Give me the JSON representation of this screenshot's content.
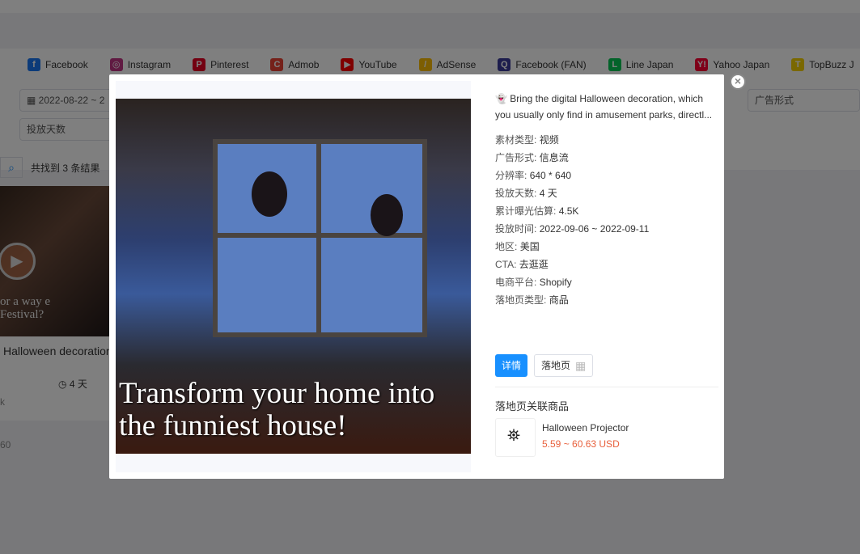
{
  "platforms": [
    {
      "label": "Facebook",
      "icon": "facebook-icon",
      "color": "#1877f2",
      "glyph": "f"
    },
    {
      "label": "Instagram",
      "icon": "instagram-icon",
      "color": "#c13584",
      "glyph": "◎"
    },
    {
      "label": "Pinterest",
      "icon": "pinterest-icon",
      "color": "#e60023",
      "glyph": "P"
    },
    {
      "label": "Admob",
      "icon": "admob-icon",
      "color": "#ea4335",
      "glyph": "C"
    },
    {
      "label": "YouTube",
      "icon": "youtube-icon",
      "color": "#ff0000",
      "glyph": "▶"
    },
    {
      "label": "AdSense",
      "icon": "adsense-icon",
      "color": "#fbbc04",
      "glyph": "/"
    },
    {
      "label": "Facebook (FAN)",
      "icon": "facebook-fan-icon",
      "color": "#3b3b9b",
      "glyph": "Q"
    },
    {
      "label": "Line Japan",
      "icon": "line-icon",
      "color": "#06c755",
      "glyph": "L"
    },
    {
      "label": "Yahoo Japan",
      "icon": "yahoo-icon",
      "color": "#ff0033",
      "glyph": "Y!"
    },
    {
      "label": "TopBuzz J",
      "icon": "topbuzz-icon",
      "color": "#f5d000",
      "glyph": "T"
    }
  ],
  "filters": {
    "date_range": "2022-08-22 ~ 2",
    "ad_format": "广告形式",
    "days": "投放天数"
  },
  "results": {
    "count_text": "共找到 3 条结果"
  },
  "card": {
    "caption": "or a way e Festival?",
    "title": "Halloween decoration",
    "days": "4 天",
    "meta1": "k",
    "meta2": "60"
  },
  "modal": {
    "video_caption": "Transform your home into the funniest house!",
    "description": "Bring the digital Halloween decoration, which you usually only find in amusement parks, directl...",
    "fields": [
      {
        "k": "素材类型:",
        "v": "视频"
      },
      {
        "k": "广告形式:",
        "v": "信息流"
      },
      {
        "k": "分辨率:",
        "v": "640 * 640"
      },
      {
        "k": "投放天数:",
        "v": "4 天"
      },
      {
        "k": "累计曝光估算:",
        "v": "4.5K"
      },
      {
        "k": "投放时间:",
        "v": "2022-09-06 ~ 2022-09-11"
      },
      {
        "k": "地区:",
        "v": "美国"
      },
      {
        "k": "CTA:",
        "v": "去逛逛"
      },
      {
        "k": "电商平台:",
        "v": "Shopify"
      },
      {
        "k": "落地页类型:",
        "v": "商品"
      }
    ],
    "details_button": "详情",
    "landing_button": "落地页",
    "related_title": "落地页关联商品",
    "product": {
      "name": "Halloween Projector",
      "price": "5.59 ~ 60.63 USD",
      "price_color": "#e8603c"
    }
  }
}
